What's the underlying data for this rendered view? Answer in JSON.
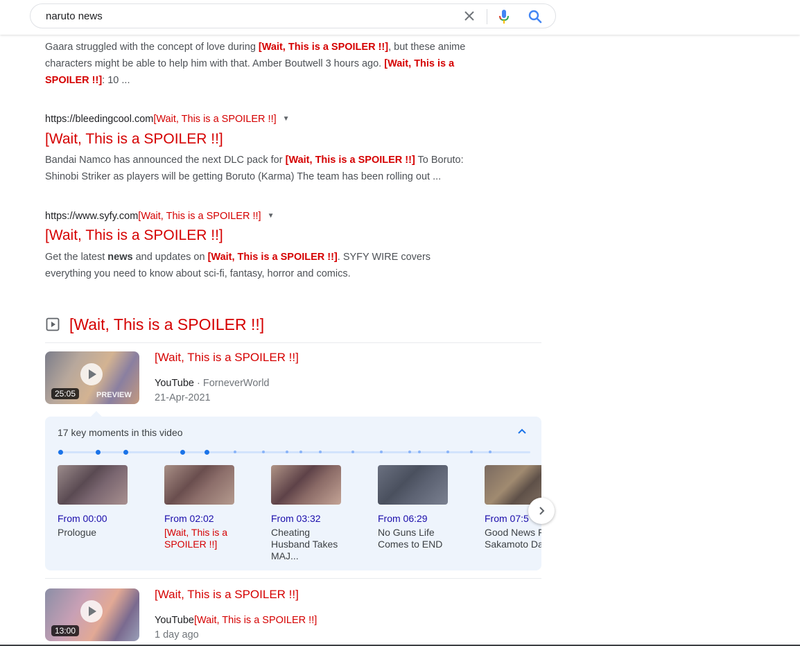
{
  "search": {
    "query": "naruto news"
  },
  "spoiler_text": "[Wait, This is a SPOILER !!]",
  "result0": {
    "line1_a": "Gaara struggled with the concept of love during ",
    "line1_b": ", but these anime",
    "line2_a": "characters might be able to help him with that. Amber Boutwell 3 hours ago. ",
    "line2_sp": "[Wait, This is a",
    "line3_sp": "SPOILER !!]",
    "line3_b": ": 10 ..."
  },
  "result1": {
    "url": "https://bleedingcool.com",
    "title": "[Wait, This is a SPOILER !!]",
    "line1_a": "Bandai Namco has announced the next DLC pack for ",
    "line1_b": " To Boruto:",
    "line2": "Shinobi Striker as players will be getting Boruto (Karma) The team has been rolling out ..."
  },
  "result2": {
    "url": "https://www.syfy.com",
    "title": "[Wait, This is a SPOILER !!]",
    "line1_a": "Get the latest ",
    "line1_bold": "news",
    "line1_b": " and updates on ",
    "line1_c": ". SYFY WIRE covers",
    "line2": "everything you need to know about sci-fi, fantasy, horror and comics."
  },
  "videos": {
    "section_title": "[Wait, This is a SPOILER !!]",
    "items": [
      {
        "title": "[Wait, This is a SPOILER !!]",
        "source": "YouTube",
        "separator": " · ",
        "channel": "ForneverWorld",
        "date": "21-Apr-2021",
        "duration": "25:05",
        "preview_label": "PREVIEW"
      },
      {
        "title": "[Wait, This is a SPOILER !!]",
        "source": "YouTube",
        "channel": "[Wait, This is a SPOILER !!]",
        "date": "1 day ago",
        "duration": "13:00"
      }
    ]
  },
  "key_moments": {
    "title": "17 key moments in this video",
    "items": [
      {
        "time": "From 00:00",
        "label": "Prologue"
      },
      {
        "time": "From 02:02",
        "label": "[Wait, This is a SPOILER !!]"
      },
      {
        "time": "From 03:32",
        "label": "Cheating Husband Takes MAJ..."
      },
      {
        "time": "From 06:29",
        "label": "No Guns Life Comes to END"
      },
      {
        "time": "From 07:5",
        "label": "Good News For Sakamoto Days"
      }
    ]
  },
  "icons": {
    "clear": "close-icon",
    "mic": "microphone-icon",
    "search": "search-icon",
    "video": "play-box-icon",
    "collapse": "chevron-up-icon",
    "next": "chevron-right-icon"
  },
  "colors": {
    "spoiler": "#d50000",
    "link_time": "#1a0dab",
    "accent": "#1a73e8",
    "key_moments_bg": "#eef4fc"
  }
}
